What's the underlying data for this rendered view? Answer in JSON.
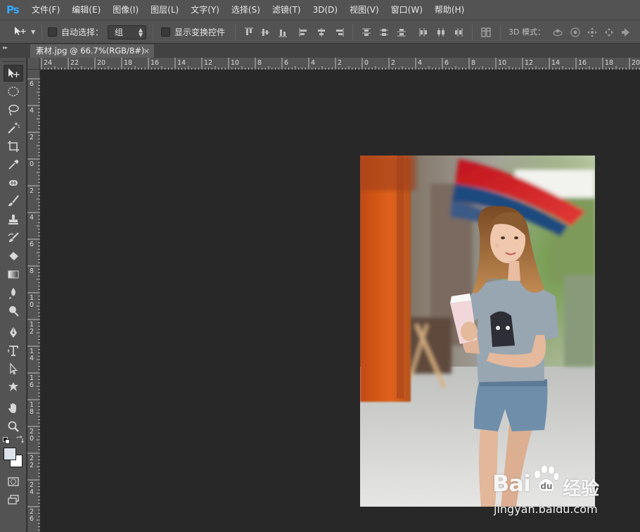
{
  "app": {
    "logo": "Ps"
  },
  "menu": [
    "文件(F)",
    "编辑(E)",
    "图像(I)",
    "图层(L)",
    "文字(Y)",
    "选择(S)",
    "滤镜(T)",
    "3D(D)",
    "视图(V)",
    "窗口(W)",
    "帮助(H)"
  ],
  "options": {
    "auto_select_label": "自动选择：",
    "auto_select_checked": false,
    "auto_select_value": "组",
    "show_transform_label": "显示变换控件",
    "show_transform_checked": false,
    "mode_3d_label": "3D 模式："
  },
  "document_tab": {
    "title": "素材.jpg @ 66.7%(RGB/8#)",
    "close": "×"
  },
  "rulers": {
    "horizontal_ticks": [
      "24",
      "22",
      "20",
      "18",
      "16",
      "14",
      "12",
      "10",
      "8",
      "6",
      "4",
      "2",
      "0",
      "2",
      "4",
      "6",
      "8",
      "10",
      "12",
      "14",
      "16",
      "18",
      "20"
    ],
    "vertical_ticks": [
      "6",
      "4",
      "2",
      "0",
      "2",
      "4",
      "6",
      "8",
      "10",
      "12",
      "14",
      "16",
      "18",
      "20",
      "22",
      "24",
      "26"
    ]
  },
  "toolbar": {
    "tools": [
      "move-tool",
      "marquee-tool",
      "lasso-tool",
      "magic-wand-tool",
      "crop-tool",
      "eyedropper-tool",
      "healing-brush-tool",
      "brush-tool",
      "clone-stamp-tool",
      "history-brush-tool",
      "eraser-tool",
      "gradient-tool",
      "blur-tool",
      "dodge-tool",
      "pen-tool",
      "type-tool",
      "path-selection-tool",
      "custom-shape-tool",
      "hand-tool",
      "zoom-tool"
    ],
    "foreground_color": "#dde3ea",
    "background_color": "#ffffff"
  },
  "watermark": {
    "brand": "Bai",
    "brand_suffix": "经验",
    "url": "jingyan.baidu.com"
  },
  "colors": {
    "panel": "#535353",
    "workspace": "#282828",
    "accent": "#31a8ff"
  }
}
